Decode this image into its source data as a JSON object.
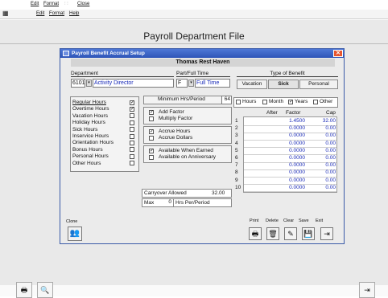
{
  "menubar_top": {
    "edit": "Edit",
    "format": "Format",
    "close": "Close"
  },
  "menubar": {
    "edit": "Edit",
    "format": "Format",
    "help": "Help"
  },
  "app": {
    "title": "Payroll Department File"
  },
  "dialog": {
    "title": "Payroll Benefit Accrual Setup",
    "employee": "Thomas Rest Haven",
    "department": {
      "label": "Department",
      "code": "6101",
      "name": "Activity Director"
    },
    "part_full": {
      "label": "Part/Full Time",
      "code": "F",
      "value": "Full Time"
    },
    "benefit_type": {
      "label": "Type of Benefit",
      "options": [
        "Vacation",
        "Sick",
        "Personal"
      ],
      "selected": "Sick"
    },
    "hours_types": [
      {
        "label": "Regular Hours",
        "checked": true
      },
      {
        "label": "Overtime Hours",
        "checked": true
      },
      {
        "label": "Vacation Hours",
        "checked": false
      },
      {
        "label": "Holiday Hours",
        "checked": false
      },
      {
        "label": "Sick Hours",
        "checked": false
      },
      {
        "label": "Inservice Hours",
        "checked": false
      },
      {
        "label": "Orientation Hours",
        "checked": false
      },
      {
        "label": "Bonus Hours",
        "checked": false
      },
      {
        "label": "Personal Hours",
        "checked": false
      },
      {
        "label": "Other Hours",
        "checked": false
      }
    ],
    "min_hrs": {
      "label": "Minimum Hrs/Period",
      "value": "64"
    },
    "factor_opts": [
      {
        "label": "Add Factor",
        "checked": true
      },
      {
        "label": "Multiply Factor",
        "checked": false
      }
    ],
    "accrue_opts": [
      {
        "label": "Accrue Hours",
        "checked": true
      },
      {
        "label": "Accrue Dollars",
        "checked": false
      }
    ],
    "avail_opts": [
      {
        "label": "Available When Earned",
        "checked": true
      },
      {
        "label": "Available on Anniversary",
        "checked": false
      }
    ],
    "carryover": {
      "label": "Carryover Allowed",
      "value": "32.00"
    },
    "max": {
      "label": "Max",
      "value": "0",
      "unit": "Hrs Per/Period"
    },
    "period_opts": [
      {
        "label": "Hours",
        "checked": false
      },
      {
        "label": "Month",
        "checked": false
      },
      {
        "label": "Years",
        "checked": true
      },
      {
        "label": "Other",
        "checked": false
      }
    ],
    "grid": {
      "headers": [
        "After",
        "Factor",
        "Cap"
      ],
      "rows": [
        {
          "n": "1",
          "factor": "1.4500",
          "cap": "32.00"
        },
        {
          "n": "2",
          "factor": "0.0000",
          "cap": "0.00"
        },
        {
          "n": "3",
          "factor": "0.0000",
          "cap": "0.00"
        },
        {
          "n": "4",
          "factor": "0.0000",
          "cap": "0.00"
        },
        {
          "n": "5",
          "factor": "0.0000",
          "cap": "0.00"
        },
        {
          "n": "6",
          "factor": "0.0000",
          "cap": "0.00"
        },
        {
          "n": "7",
          "factor": "0.0000",
          "cap": "0.00"
        },
        {
          "n": "8",
          "factor": "0.0000",
          "cap": "0.00"
        },
        {
          "n": "9",
          "factor": "0.0000",
          "cap": "0.00"
        },
        {
          "n": "10",
          "factor": "0.0000",
          "cap": "0.00"
        }
      ]
    },
    "clone_label": "Clone",
    "toolbar": {
      "print": "Print",
      "delete": "Delete",
      "clear": "Clear",
      "save": "Save",
      "exit": "Exit"
    }
  },
  "icons": {
    "print": "printer-icon",
    "delete": "trash-icon",
    "clear": "eraser-icon",
    "save": "floppy-icon",
    "exit": "exit-door-icon",
    "clone": "people-icon"
  }
}
